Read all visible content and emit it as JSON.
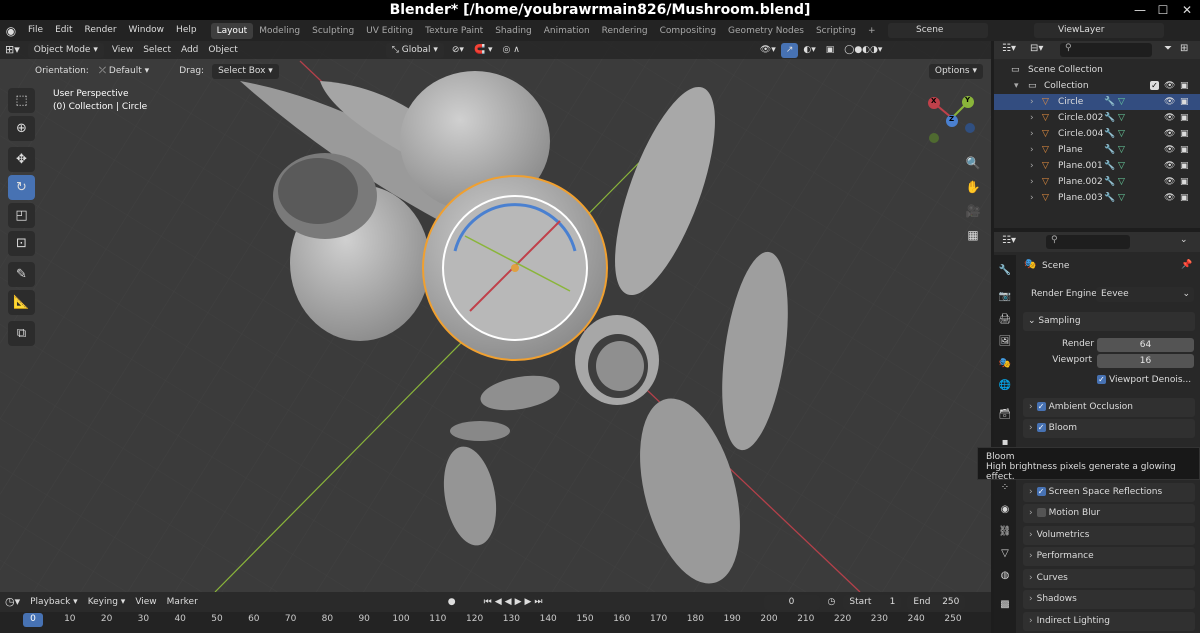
{
  "window": {
    "title": "Blender* [/home/youbrawrmain826/Mushroom.blend]",
    "minimize": "—",
    "maximize": "☐",
    "close": "✕"
  },
  "menus": [
    "File",
    "Edit",
    "Render",
    "Window",
    "Help"
  ],
  "workspaces": [
    "Layout",
    "Modeling",
    "Sculpting",
    "UV Editing",
    "Texture Paint",
    "Shading",
    "Animation",
    "Rendering",
    "Compositing",
    "Geometry Nodes",
    "Scripting"
  ],
  "active_workspace": "Layout",
  "add_workspace": "+",
  "scene": {
    "name": "Scene",
    "view_layer": "ViewLayer"
  },
  "viewport": {
    "mode": "Object Mode",
    "menu": [
      "View",
      "Select",
      "Add",
      "Object"
    ],
    "transform": "Global",
    "orientation_label": "Orientation:",
    "orientation_value": "Default",
    "drag_label": "Drag:",
    "drag_value": "Select Box",
    "options": "Options",
    "overlay_title": "User Perspective",
    "overlay_sub": "(0) Collection | Circle",
    "gizmo": {
      "x": "X",
      "y": "Y",
      "z": "Z"
    }
  },
  "outliner": {
    "root": "Scene Collection",
    "collection": "Collection",
    "objects": [
      "Circle",
      "Circle.002",
      "Circle.004",
      "Plane",
      "Plane.001",
      "Plane.002",
      "Plane.003"
    ],
    "selected": "Circle"
  },
  "properties": {
    "context": "Scene",
    "render_engine_label": "Render Engine",
    "render_engine": "Eevee",
    "sampling": {
      "title": "Sampling",
      "render_label": "Render",
      "render": "64",
      "viewport_label": "Viewport",
      "viewport": "16",
      "denoise": "Viewport Denois..."
    },
    "panels": [
      {
        "label": "Ambient Occlusion",
        "checked": true
      },
      {
        "label": "Bloom",
        "checked": true
      },
      {
        "label": "Screen Space Reflections",
        "checked": true
      },
      {
        "label": "Motion Blur",
        "checked": false
      },
      {
        "label": "Volumetrics"
      },
      {
        "label": "Performance"
      },
      {
        "label": "Curves"
      },
      {
        "label": "Shadows"
      },
      {
        "label": "Indirect Lighting"
      }
    ]
  },
  "tooltip": {
    "title": "Bloom",
    "text": "High brightness pixels generate a glowing effect."
  },
  "timeline": {
    "menus": [
      "Playback",
      "Keying",
      "View",
      "Marker"
    ],
    "current_frame": "0",
    "start_label": "Start",
    "start": "1",
    "end_label": "End",
    "end": "250",
    "ticks": [
      "0",
      "10",
      "20",
      "30",
      "40",
      "50",
      "60",
      "70",
      "80",
      "90",
      "100",
      "110",
      "120",
      "130",
      "140",
      "150",
      "160",
      "170",
      "180",
      "190",
      "200",
      "210",
      "220",
      "230",
      "240",
      "250"
    ]
  },
  "colors": {
    "accent": "#4772b3",
    "selection_outline": "#f0a030",
    "x_axis": "#c0404a",
    "y_axis": "#8ab53a"
  }
}
